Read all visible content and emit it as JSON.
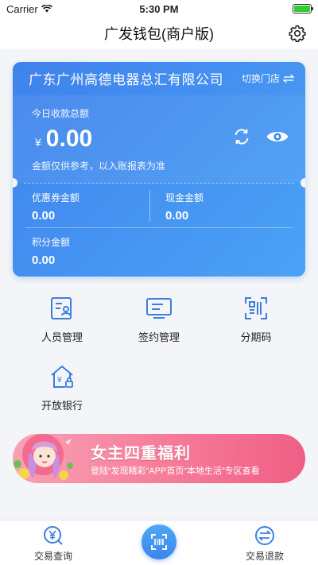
{
  "status": {
    "carrier": "Carrier",
    "time": "5:30 PM",
    "battery_level": 1.0
  },
  "nav": {
    "title": "广发钱包(商户版)",
    "settings_icon": "gear-icon"
  },
  "card": {
    "company": "广东广州高德电器总汇有限公司",
    "switch_store": "切换门店",
    "amount_label": "今日收款总额",
    "currency": "¥",
    "amount": "0.00",
    "note": "金额仅供参考，以入账报表为准",
    "coupon_label": "优惠券金额",
    "coupon_value": "0.00",
    "cash_label": "现金金额",
    "cash_value": "0.00",
    "points_label": "积分金额",
    "points_value": "0.00"
  },
  "menu": [
    {
      "label": "人员管理",
      "icon": "staff-icon"
    },
    {
      "label": "签约管理",
      "icon": "contract-icon"
    },
    {
      "label": "分期码",
      "icon": "installment-code-icon"
    },
    {
      "label": "开放银行",
      "icon": "open-bank-icon"
    }
  ],
  "banner": {
    "title": "女主四重福利",
    "subtitle": "登陆“发现精彩”APP首页“本地生活”专区查看"
  },
  "tabs": {
    "left": "交易查询",
    "right": "交易退款"
  },
  "colors": {
    "accent": "#3f82ec",
    "banner": "#f7819d"
  }
}
